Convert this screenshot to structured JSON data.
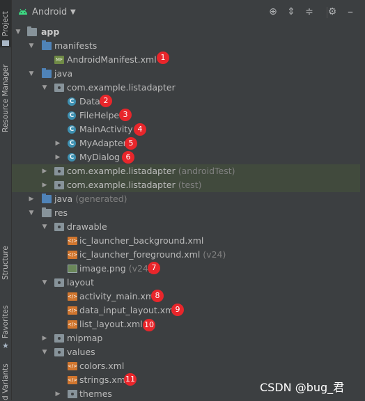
{
  "header": {
    "title": "Android",
    "icons": [
      "locate-icon",
      "expand-all-icon",
      "collapse-all-icon",
      "gear-icon",
      "hide-icon"
    ]
  },
  "tool_stripe": {
    "project": "Project",
    "resource_manager": "Resource Manager",
    "structure": "Structure",
    "favorites": "Favorites",
    "build_variants": "d Variants"
  },
  "tree": {
    "app": "app",
    "manifests": "manifests",
    "android_manifest": "AndroidManifest.xml",
    "java": "java",
    "pkg_main": "com.example.listadapter",
    "data": "Data",
    "file_helper": "FileHelper",
    "main_activity": "MainActivity",
    "my_adapter": "MyAdapter",
    "my_dialog": "MyDialog",
    "pkg_android_test": "com.example.listadapter",
    "pkg_android_test_suffix": "(androidTest)",
    "pkg_test": "com.example.listadapter",
    "pkg_test_suffix": "(test)",
    "java_generated": "java",
    "java_generated_suffix": "(generated)",
    "res": "res",
    "drawable": "drawable",
    "ic_bg": "ic_launcher_background.xml",
    "ic_fg": "ic_launcher_foreground.xml",
    "ic_fg_suffix": "(v24)",
    "image_png": "image.png",
    "image_png_suffix": "(v24)",
    "layout": "layout",
    "activity_main": "activity_main.xml",
    "data_input_layout": "data_input_layout.xml",
    "list_layout": "list_layout.xml",
    "mipmap": "mipmap",
    "values": "values",
    "colors": "colors.xml",
    "strings": "strings.xml",
    "themes": "themes"
  },
  "badges": [
    "1",
    "2",
    "3",
    "4",
    "5",
    "6",
    "7",
    "8",
    "9",
    "10",
    "11"
  ],
  "watermark": "CSDN @bug_君",
  "colors": {
    "panel": "#3c3f41",
    "highlight_row": "#414a3d",
    "badge": "#e8262b",
    "class_icon": "#3d8fb0",
    "xml_icon": "#d1762e"
  }
}
